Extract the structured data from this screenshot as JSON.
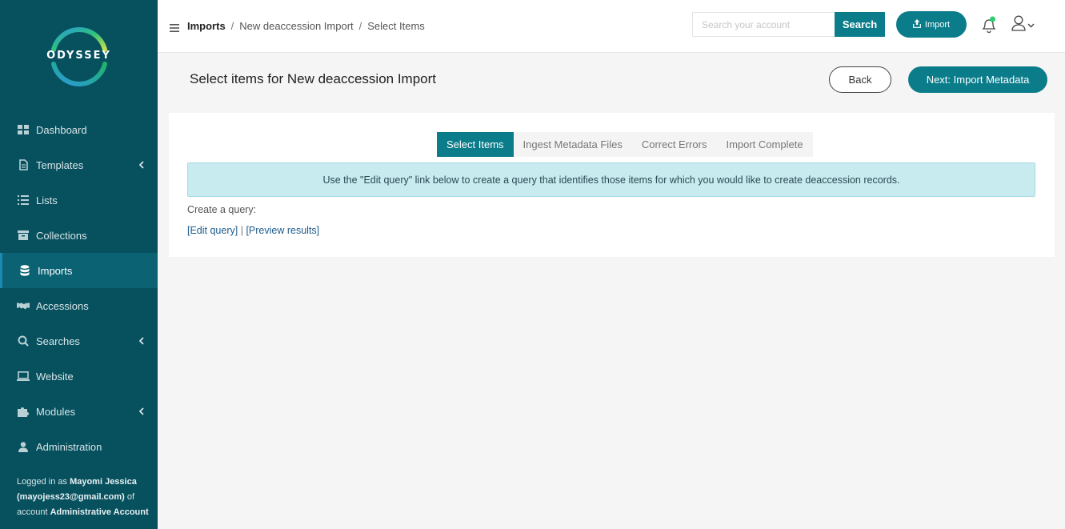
{
  "brand": {
    "name": "ODYSSEY"
  },
  "sidebar": {
    "items": [
      {
        "label": "Dashboard",
        "icon": "dashboard-icon",
        "has_submenu": false
      },
      {
        "label": "Templates",
        "icon": "file-icon",
        "has_submenu": true
      },
      {
        "label": "Lists",
        "icon": "list-icon",
        "has_submenu": false
      },
      {
        "label": "Collections",
        "icon": "archive-icon",
        "has_submenu": false
      },
      {
        "label": "Imports",
        "icon": "database-icon",
        "has_submenu": false,
        "active": true
      },
      {
        "label": "Accessions",
        "icon": "handshake-icon",
        "has_submenu": false
      },
      {
        "label": "Searches",
        "icon": "search-icon",
        "has_submenu": true
      },
      {
        "label": "Website",
        "icon": "laptop-icon",
        "has_submenu": false
      },
      {
        "label": "Modules",
        "icon": "puzzle-icon",
        "has_submenu": true
      },
      {
        "label": "Administration",
        "icon": "user-icon",
        "has_submenu": false
      }
    ],
    "login": {
      "prefix": "Logged in as",
      "user": "Mayomi Jessica (mayojess23@gmail.com)",
      "middle": "of account",
      "account": "Administrative Account"
    }
  },
  "topbar": {
    "breadcrumb": [
      "Imports",
      "New deaccession Import",
      "Select Items"
    ],
    "breadcrumb_separator": "/",
    "search": {
      "placeholder": "Search your account",
      "value": "",
      "button_label": "Search"
    },
    "import_label": "Import"
  },
  "page": {
    "title": "Select items for New deaccession Import",
    "back_label": "Back",
    "next_label": "Next: Import Metadata"
  },
  "steps": [
    {
      "label": "Select Items",
      "active": true
    },
    {
      "label": "Ingest Metadata Files",
      "active": false
    },
    {
      "label": "Correct Errors",
      "active": false
    },
    {
      "label": "Import Complete",
      "active": false
    }
  ],
  "content": {
    "info": "Use the \"Edit query\" link below to create a query that identifies those items for which you would like to create deaccession records.",
    "query_label": "Create a query:",
    "edit_query": "[Edit query]",
    "link_separator": "|",
    "preview_results": "[Preview results]"
  },
  "colors": {
    "sidebar_bg": "#07505e",
    "accent": "#0a7c8a",
    "info_bg": "#c8ebf0",
    "notification_dot": "#2ecc71"
  }
}
